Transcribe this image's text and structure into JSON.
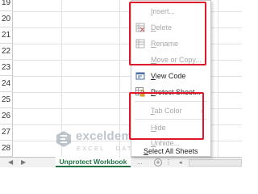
{
  "rows": [
    "19",
    "20",
    "21",
    "22",
    "23",
    "24",
    "25",
    "26",
    "27",
    "28",
    "29"
  ],
  "watermark": {
    "name": "exceldemy",
    "subtitle": "EXCEL · DATA · BI"
  },
  "tabbar": {
    "prev_icon": "triangle-left-icon",
    "next_icon": "triangle-right-icon",
    "sheet_tab_label": "Unprotect Workbook",
    "more_left": "...",
    "add_label": "+",
    "more_right": "⋮",
    "scroll_left": "◂"
  },
  "context_menu": {
    "items": [
      {
        "label": "Insert...",
        "mnemonic": "I",
        "rest": "nsert...",
        "icon": "insert-icon",
        "disabled": true
      },
      {
        "label": "Delete",
        "mnemonic": "D",
        "rest": "elete",
        "icon": "delete-sheet-icon",
        "disabled": true
      },
      {
        "label": "Rename",
        "mnemonic": "R",
        "rest": "ename",
        "icon": "rename-icon",
        "disabled": true
      },
      {
        "label": "Move or Copy...",
        "mnemonic": "M",
        "rest": "ove or Copy...",
        "icon": "",
        "disabled": true
      },
      {
        "label": "View Code",
        "mnemonic": "V",
        "rest": "iew Code",
        "icon": "view-code-icon",
        "disabled": false
      },
      {
        "label": "Protect Sheet...",
        "mnemonic": "P",
        "rest": "rotect Sheet...",
        "icon": "protect-sheet-icon",
        "disabled": false
      },
      {
        "label": "Tab Color",
        "mnemonic": "T",
        "rest": "ab Color",
        "icon": "",
        "disabled": true,
        "submenu": "›"
      },
      {
        "label": "Hide",
        "mnemonic": "H",
        "rest": "ide",
        "icon": "",
        "disabled": true
      },
      {
        "label": "Unhide...",
        "mnemonic": "U",
        "rest": "nhide...",
        "icon": "",
        "disabled": true
      },
      {
        "label": "Select All Sheets",
        "mnemonic": "S",
        "rest": "elect All Sheets",
        "icon": "",
        "disabled": false
      }
    ]
  },
  "colors": {
    "highlight": "#e0162b",
    "excel_green": "#217346",
    "disabled_text": "#a8a8a8"
  }
}
